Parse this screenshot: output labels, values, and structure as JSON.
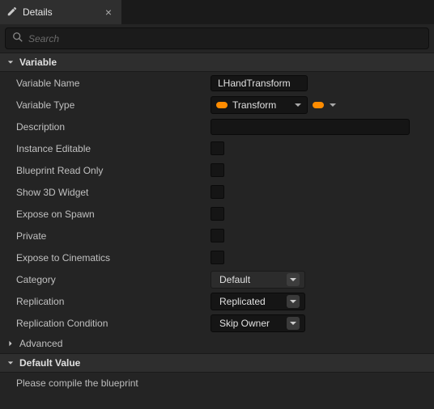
{
  "tab": {
    "title": "Details"
  },
  "search": {
    "placeholder": "Search"
  },
  "sections": {
    "variable": "Variable",
    "advanced": "Advanced",
    "default_value": "Default Value"
  },
  "rows": {
    "variable_name": {
      "label": "Variable Name",
      "value": "LHandTransform"
    },
    "variable_type": {
      "label": "Variable Type",
      "value": "Transform"
    },
    "description": {
      "label": "Description",
      "value": ""
    },
    "instance_editable": {
      "label": "Instance Editable"
    },
    "blueprint_read_only": {
      "label": "Blueprint Read Only"
    },
    "show_3d_widget": {
      "label": "Show 3D Widget"
    },
    "expose_on_spawn": {
      "label": "Expose on Spawn"
    },
    "private": {
      "label": "Private"
    },
    "expose_to_cinematics": {
      "label": "Expose to Cinematics"
    },
    "category": {
      "label": "Category",
      "value": "Default"
    },
    "replication": {
      "label": "Replication",
      "value": "Replicated"
    },
    "replication_condition": {
      "label": "Replication Condition",
      "value": "Skip Owner"
    }
  },
  "default_value_message": "Please compile the blueprint"
}
